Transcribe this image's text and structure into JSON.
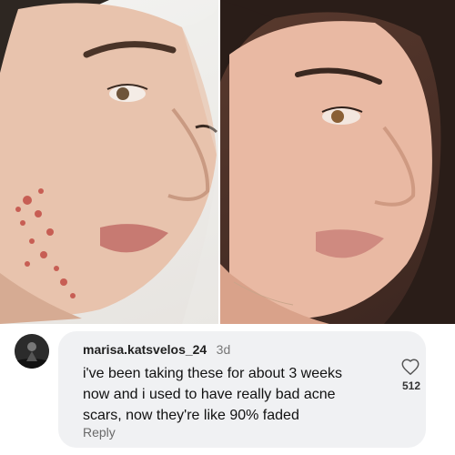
{
  "comment": {
    "username": "marisa.katsvelos_24",
    "timestamp": "3d",
    "text_lines": [
      "i've been taking these for about 3 weeks",
      "now and i used to have really bad acne",
      "scars, now they're like 90% faded"
    ],
    "reply_label": "Reply",
    "like_count": "512"
  },
  "icons": {
    "like": "heart-outline-icon",
    "avatar": "user-avatar"
  },
  "colors": {
    "bubble_bg": "#f0f1f3",
    "text": "#111111",
    "muted": "#777777",
    "page_bg": "#ffffff"
  }
}
